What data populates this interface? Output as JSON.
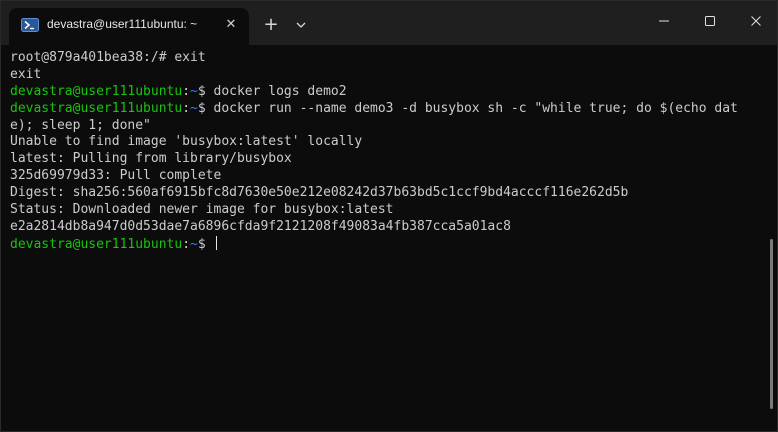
{
  "tab": {
    "title": "devastra@user111ubuntu: ~",
    "close_glyph": "✕",
    "icon": "powershell-icon"
  },
  "titlebar": {
    "new_tab_glyph": "+",
    "dropdown_icon": "chevron-down-icon",
    "minimize_icon": "minimize-icon",
    "maximize_icon": "maximize-icon",
    "close_icon": "close-icon"
  },
  "colors": {
    "background": "#0c0c0c",
    "titlebar": "#1f1f1f",
    "prompt_user": "#16c60c",
    "prompt_path": "#3b78ff",
    "text": "#cccccc"
  },
  "terminal": {
    "lines": [
      {
        "kind": "plain",
        "text": "root@879a401bea38:/# exit"
      },
      {
        "kind": "plain",
        "text": "exit"
      },
      {
        "kind": "prompt",
        "user": "devastra@user111ubuntu",
        "sep": ":",
        "path": "~",
        "cmd": "$ docker logs demo2"
      },
      {
        "kind": "prompt",
        "user": "devastra@user111ubuntu",
        "sep": ":",
        "path": "~",
        "cmd": "$ docker run --name demo3 -d busybox sh -c \"while true; do $(echo dat"
      },
      {
        "kind": "plain",
        "text": "e); sleep 1; done\""
      },
      {
        "kind": "plain",
        "text": "Unable to find image 'busybox:latest' locally"
      },
      {
        "kind": "plain",
        "text": "latest: Pulling from library/busybox"
      },
      {
        "kind": "plain",
        "text": "325d69979d33: Pull complete"
      },
      {
        "kind": "plain",
        "text": "Digest: sha256:560af6915bfc8d7630e50e212e08242d37b63bd5c1ccf9bd4acccf116e262d5b"
      },
      {
        "kind": "plain",
        "text": "Status: Downloaded newer image for busybox:latest"
      },
      {
        "kind": "plain",
        "text": "e2a2814db8a947d0d53dae7a6896cfda9f2121208f49083a4fb387cca5a01ac8"
      },
      {
        "kind": "prompt",
        "user": "devastra@user111ubuntu",
        "sep": ":",
        "path": "~",
        "cmd": "$ ",
        "cursor": true
      }
    ]
  }
}
